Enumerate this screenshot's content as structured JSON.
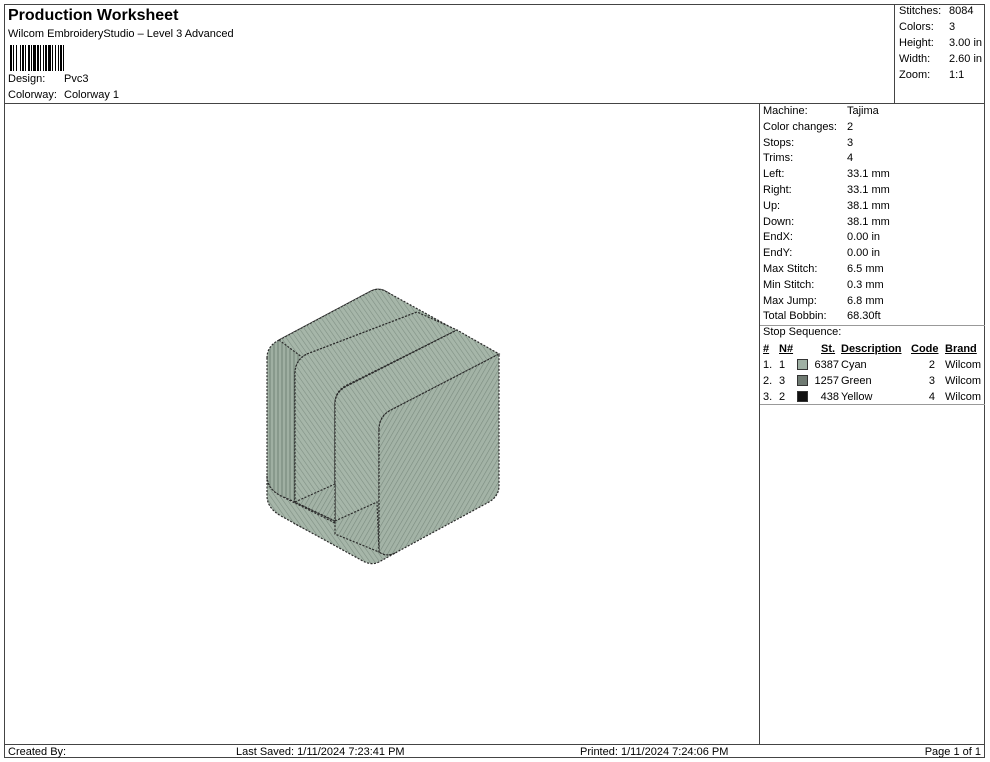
{
  "header": {
    "title": "Production Worksheet",
    "subtitle": "Wilcom EmbroideryStudio – Level 3 Advanced",
    "design_label": "Design:",
    "design_value": "Pvc3",
    "colorway_label": "Colorway:",
    "colorway_value": "Colorway 1"
  },
  "summary": {
    "stitches_label": "Stitches:",
    "stitches_value": "8084",
    "colors_label": "Colors:",
    "colors_value": "3",
    "height_label": "Height:",
    "height_value": "3.00 in",
    "width_label": "Width:",
    "width_value": "2.60 in",
    "zoom_label": "Zoom:",
    "zoom_value": "1:1"
  },
  "machine": [
    {
      "label": "Machine:",
      "value": "Tajima"
    },
    {
      "label": "Color changes:",
      "value": "2"
    },
    {
      "label": "Stops:",
      "value": "3"
    },
    {
      "label": "Trims:",
      "value": "4"
    },
    {
      "label": "Left:",
      "value": "33.1 mm"
    },
    {
      "label": "Right:",
      "value": "33.1 mm"
    },
    {
      "label": "Up:",
      "value": "38.1 mm"
    },
    {
      "label": "Down:",
      "value": "38.1 mm"
    },
    {
      "label": "EndX:",
      "value": "0.00 in"
    },
    {
      "label": "EndY:",
      "value": "0.00 in"
    },
    {
      "label": "Max Stitch:",
      "value": "6.5 mm"
    },
    {
      "label": "Min Stitch:",
      "value": "0.3 mm"
    },
    {
      "label": "Max Jump:",
      "value": "6.8 mm"
    },
    {
      "label": "Total Bobbin:",
      "value": "68.30ft"
    }
  ],
  "stop_sequence": {
    "title": "Stop Sequence:",
    "headers": {
      "num": "#",
      "n": "N#",
      "st": "St.",
      "description": "Description",
      "code": "Code",
      "brand": "Brand"
    },
    "rows": [
      {
        "num": "1.",
        "n": "1",
        "color": "#9fb0a4",
        "st": "6387",
        "description": "Cyan",
        "code": "2",
        "brand": "Wilcom"
      },
      {
        "num": "2.",
        "n": "3",
        "color": "#6f7a72",
        "st": "1257",
        "description": "Green",
        "code": "3",
        "brand": "Wilcom"
      },
      {
        "num": "3.",
        "n": "2",
        "color": "#111111",
        "st": "438",
        "description": "Yellow",
        "code": "4",
        "brand": "Wilcom"
      }
    ]
  },
  "footer": {
    "created_by": "Created By:",
    "last_saved": "Last Saved: 1/11/2024 7:23:41 PM",
    "printed": "Printed: 1/11/2024 7:24:06 PM",
    "page": "Page 1 of 1"
  },
  "design_colors": {
    "fill": "#9aab9e",
    "fill_dark": "#7d8e82",
    "outline": "#2a2a2a"
  }
}
